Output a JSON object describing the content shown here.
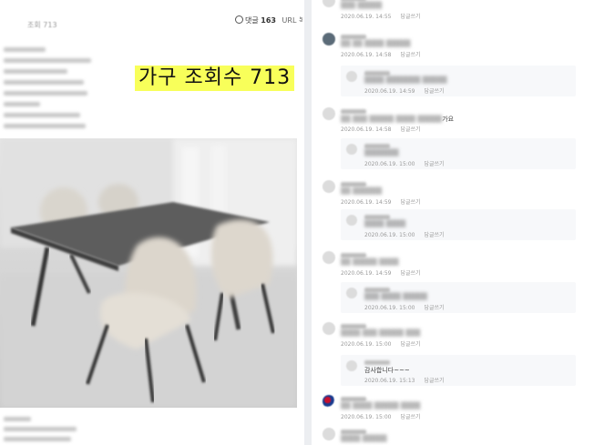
{
  "post": {
    "views_label": "조회 713",
    "comment_count_label": "댓글",
    "comment_count": "163",
    "url_label": "URL 복사",
    "overlay_caption": "가구 조회수 713"
  },
  "colors": {
    "caption_highlight": "#f8ff5a",
    "divider": "#eceef1",
    "reply_background": "#f7f8fa",
    "meta_text": "#9a9a9a"
  },
  "comments": [
    {
      "type": "comment",
      "avatar": "plain",
      "text_blur": "▒▒▒ ▒▒▒▒▒",
      "text": "",
      "date": "2020.06.19. 14:55",
      "reply_label": "답글쓰기"
    },
    {
      "type": "comment",
      "avatar": "dark",
      "text_blur": "▒▒ ▒▒ ▒▒▒▒ ▒▒▒▒▒",
      "text": "",
      "date": "2020.06.19. 14:58",
      "reply_label": "답글쓰기"
    },
    {
      "type": "reply",
      "avatar": "plain",
      "text_blur": "▒▒▒▒ ▒▒▒▒▒▒▒ ▒▒▒▒▒",
      "text": "",
      "date": "2020.06.19. 14:59",
      "reply_label": "답글쓰기"
    },
    {
      "type": "comment",
      "avatar": "plain",
      "text_blur": "▒▒ ▒▒▒ ▒▒▒▒▒ ▒▒▒▒ ▒▒▒▒▒",
      "text": "가요",
      "date": "2020.06.19. 14:58",
      "reply_label": "답글쓰기"
    },
    {
      "type": "reply",
      "avatar": "plain",
      "text_blur": "▒▒▒▒▒▒▒",
      "text": "",
      "date": "2020.06.19. 15:00",
      "reply_label": "답글쓰기"
    },
    {
      "type": "comment",
      "avatar": "plain",
      "text_blur": "▒▒ ▒▒▒▒▒▒",
      "text": "",
      "date": "2020.06.19. 14:59",
      "reply_label": "답글쓰기"
    },
    {
      "type": "reply",
      "avatar": "plain",
      "text_blur": "▒▒▒▒ ▒▒▒▒",
      "text": "",
      "date": "2020.06.19. 15:00",
      "reply_label": "답글쓰기"
    },
    {
      "type": "comment",
      "avatar": "plain",
      "text_blur": "▒▒ ▒▒▒▒▒ ▒▒▒▒",
      "text": "",
      "date": "2020.06.19. 14:59",
      "reply_label": "답글쓰기"
    },
    {
      "type": "reply",
      "avatar": "plain",
      "text_blur": "▒▒▒ ▒▒▒▒ ▒▒▒▒▒",
      "text": "",
      "date": "2020.06.19. 15:00",
      "reply_label": "답글쓰기"
    },
    {
      "type": "comment",
      "avatar": "plain",
      "text_blur": "▒▒▒▒ ▒▒▒ ▒▒▒▒▒ ▒▒▒",
      "text": "",
      "date": "2020.06.19. 15:00",
      "reply_label": "답글쓰기"
    },
    {
      "type": "reply",
      "avatar": "plain",
      "text_blur": "",
      "text": "감사합니다~~~",
      "date": "2020.06.19. 15:13",
      "reply_label": "답글쓰기"
    },
    {
      "type": "comment",
      "avatar": "flag",
      "text_blur": "▒▒ ▒▒▒▒ ▒▒▒▒▒ ▒▒▒▒",
      "text": "",
      "date": "2020.06.19. 15:00",
      "reply_label": "답글쓰기"
    },
    {
      "type": "comment",
      "avatar": "plain",
      "text_blur": "▒▒▒▒ ▒▒▒▒▒",
      "text": "",
      "date": "",
      "reply_label": ""
    }
  ]
}
